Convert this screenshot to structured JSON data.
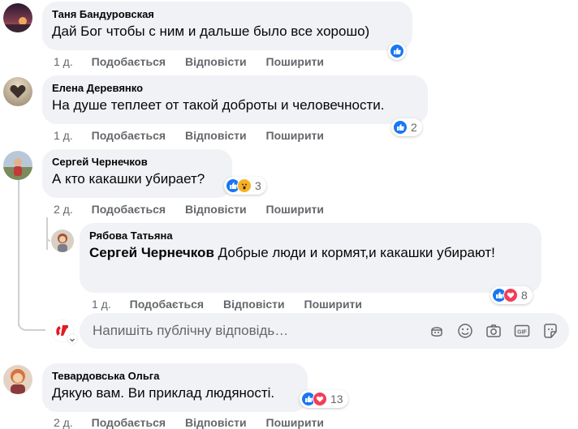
{
  "comments": [
    {
      "author": "Таня Бандуровская",
      "text": "Дай Бог чтобы с ним и дальше было все хорошо)",
      "time": "1 д.",
      "like": "Подобається",
      "reply": "Відповісти",
      "share": "Поширити",
      "reactions": [
        "like-icon"
      ],
      "count": ""
    },
    {
      "author": "Елена Деревянко",
      "text": "На душе теплеет от такой доброты и человечности.",
      "time": "1 д.",
      "like": "Подобається",
      "reply": "Відповісти",
      "share": "Поширити",
      "reactions": [
        "like-icon"
      ],
      "count": "2"
    },
    {
      "author": "Сергей Чернечков",
      "text": "А кто какашки убирает?",
      "time": "2 д.",
      "like": "Подобається",
      "reply": "Відповісти",
      "share": "Поширити",
      "reactions": [
        "like-icon",
        "wow-icon"
      ],
      "count": "3"
    },
    {
      "author": "Тевардовська Ольга",
      "text": "Дякую вам. Ви приклад людяності.",
      "time": "2 д.",
      "like": "Подобається",
      "reply": "Відповісти",
      "share": "Поширити",
      "reactions": [
        "like-icon",
        "love-icon"
      ],
      "count": "13"
    }
  ],
  "reply": {
    "author": "Рябова Татьяна",
    "mention": "Сергей Чернечков",
    "text": " Добрые люди и кормят,и какашки убирают!",
    "time": "1 д.",
    "like": "Подобається",
    "reply": "Відповісти",
    "share": "Поширити",
    "reactions": [
      "like-icon",
      "love-icon"
    ],
    "count": "8"
  },
  "reply_box": {
    "placeholder": "Напишіть публічну відповідь…",
    "tools": [
      "sticker-icon",
      "emoji-icon",
      "camera-icon",
      "gif-icon",
      "sticker-face-icon"
    ]
  },
  "colors": {
    "bubble": "#f0f2f5",
    "like": "#1877f2",
    "love": "#f33e58",
    "wow": "#f7b125",
    "meta_text": "#65676b",
    "thread_line": "#ced0d4"
  }
}
